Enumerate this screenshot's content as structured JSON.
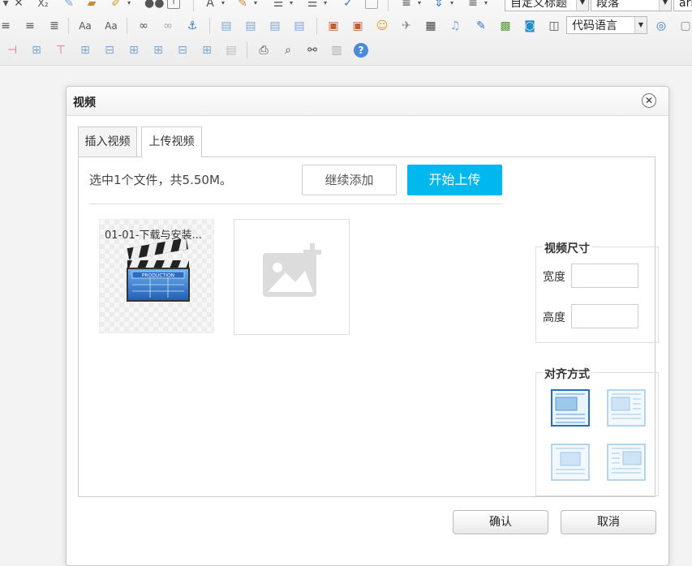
{
  "toolbar": {
    "heading_select": "自定义标题",
    "paragraph_select": "段落",
    "font_select": "ari",
    "code_select": "代码语言"
  },
  "dialog": {
    "title": "视频",
    "close_symbol": "✕",
    "tabs": [
      {
        "label": "插入视频",
        "active": false
      },
      {
        "label": "上传视频",
        "active": true
      }
    ],
    "upload": {
      "info": "选中1个文件，共5.50M。",
      "add_more_label": "继续添加",
      "start_label": "开始上传",
      "file_name": "01-01-下载与安装...",
      "accent": "#00b7ee"
    },
    "size_section": {
      "legend": "视频尺寸",
      "width_label": "宽度",
      "width_value": "",
      "height_label": "高度",
      "height_value": ""
    },
    "align_section": {
      "legend": "对齐方式",
      "options": [
        "align-none",
        "align-left",
        "align-center",
        "align-right"
      ],
      "selected": "align-none"
    },
    "footer": {
      "ok_label": "确认",
      "cancel_label": "取消"
    }
  }
}
